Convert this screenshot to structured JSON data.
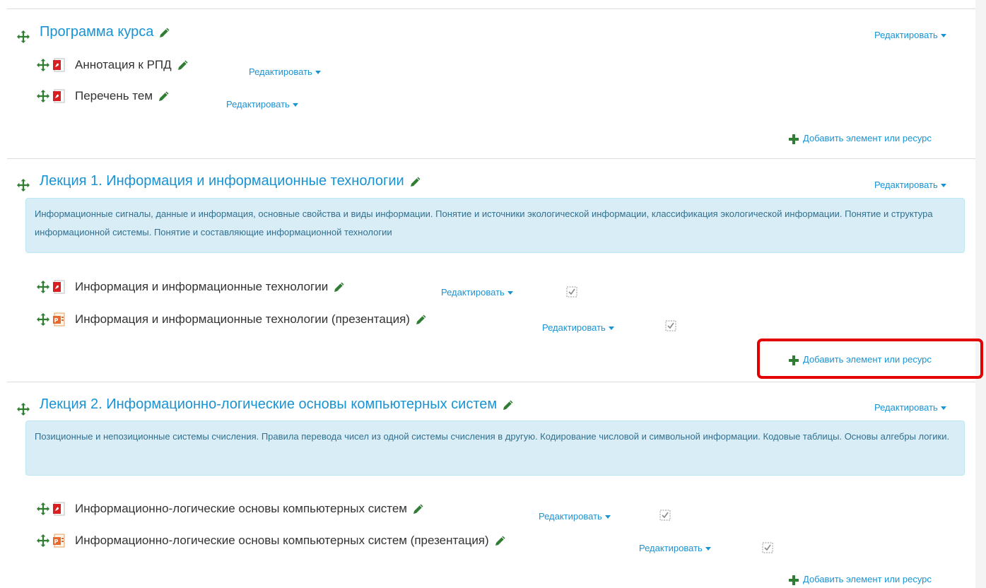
{
  "edit_label": "Редактировать",
  "add_label": "Добавить элемент или ресурс",
  "colors": {
    "link": "#1a93d3",
    "move_icon": "#2e7d32",
    "summary_bg": "#d9edf7",
    "summary_text": "#31708f",
    "highlight": "#e30000"
  },
  "sections": [
    {
      "title": "Программа курса",
      "activities": [
        {
          "name": "Аннотация к РПД",
          "icon": "pdf-icon"
        },
        {
          "name": "Перечень тем",
          "icon": "pdf-icon"
        }
      ]
    },
    {
      "title": "Лекция 1. Информация и информационные технологии",
      "summary": "Информационные сигналы, данные и информация, основные свойства и виды информации. Понятие и источники экологической информации, классификация экологической информации. Понятие и структура информационной системы. Понятие и составляющие информационной технологии",
      "activities": [
        {
          "name": "Информация и информационные технологии",
          "icon": "pdf-icon"
        },
        {
          "name": "Информация и информационные технологии (презентация)",
          "icon": "powerpoint-icon"
        }
      ]
    },
    {
      "title": "Лекция 2. Информационно-логические основы компьютерных систем",
      "summary": "Позиционные и непозиционные системы счисления. Правила перевода чисел из одной системы счисления в другую. Кодирование числовой и символьной информации. Кодовые таблицы. Основы алгебры логики.",
      "activities": [
        {
          "name": "Информационно-логические основы компьютерных систем",
          "icon": "pdf-icon"
        },
        {
          "name": "Информационно-логические основы компьютерных систем (презентация)",
          "icon": "powerpoint-icon"
        }
      ]
    }
  ]
}
